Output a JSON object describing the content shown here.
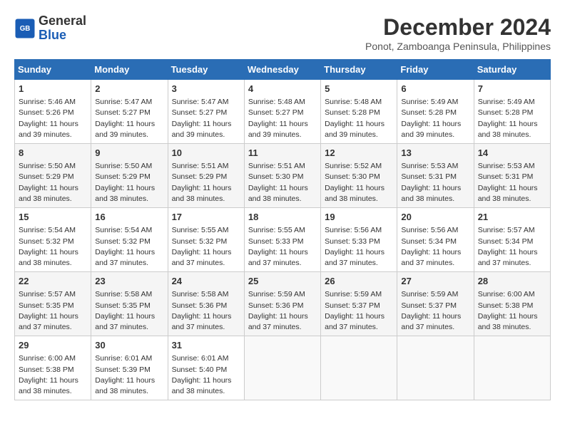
{
  "logo": {
    "line1": "General",
    "line2": "Blue"
  },
  "title": "December 2024",
  "location": "Ponot, Zamboanga Peninsula, Philippines",
  "days_header": [
    "Sunday",
    "Monday",
    "Tuesday",
    "Wednesday",
    "Thursday",
    "Friday",
    "Saturday"
  ],
  "weeks": [
    [
      {
        "day": "1",
        "info": "Sunrise: 5:46 AM\nSunset: 5:26 PM\nDaylight: 11 hours\nand 39 minutes."
      },
      {
        "day": "2",
        "info": "Sunrise: 5:47 AM\nSunset: 5:27 PM\nDaylight: 11 hours\nand 39 minutes."
      },
      {
        "day": "3",
        "info": "Sunrise: 5:47 AM\nSunset: 5:27 PM\nDaylight: 11 hours\nand 39 minutes."
      },
      {
        "day": "4",
        "info": "Sunrise: 5:48 AM\nSunset: 5:27 PM\nDaylight: 11 hours\nand 39 minutes."
      },
      {
        "day": "5",
        "info": "Sunrise: 5:48 AM\nSunset: 5:28 PM\nDaylight: 11 hours\nand 39 minutes."
      },
      {
        "day": "6",
        "info": "Sunrise: 5:49 AM\nSunset: 5:28 PM\nDaylight: 11 hours\nand 39 minutes."
      },
      {
        "day": "7",
        "info": "Sunrise: 5:49 AM\nSunset: 5:28 PM\nDaylight: 11 hours\nand 38 minutes."
      }
    ],
    [
      {
        "day": "8",
        "info": "Sunrise: 5:50 AM\nSunset: 5:29 PM\nDaylight: 11 hours\nand 38 minutes."
      },
      {
        "day": "9",
        "info": "Sunrise: 5:50 AM\nSunset: 5:29 PM\nDaylight: 11 hours\nand 38 minutes."
      },
      {
        "day": "10",
        "info": "Sunrise: 5:51 AM\nSunset: 5:29 PM\nDaylight: 11 hours\nand 38 minutes."
      },
      {
        "day": "11",
        "info": "Sunrise: 5:51 AM\nSunset: 5:30 PM\nDaylight: 11 hours\nand 38 minutes."
      },
      {
        "day": "12",
        "info": "Sunrise: 5:52 AM\nSunset: 5:30 PM\nDaylight: 11 hours\nand 38 minutes."
      },
      {
        "day": "13",
        "info": "Sunrise: 5:53 AM\nSunset: 5:31 PM\nDaylight: 11 hours\nand 38 minutes."
      },
      {
        "day": "14",
        "info": "Sunrise: 5:53 AM\nSunset: 5:31 PM\nDaylight: 11 hours\nand 38 minutes."
      }
    ],
    [
      {
        "day": "15",
        "info": "Sunrise: 5:54 AM\nSunset: 5:32 PM\nDaylight: 11 hours\nand 38 minutes."
      },
      {
        "day": "16",
        "info": "Sunrise: 5:54 AM\nSunset: 5:32 PM\nDaylight: 11 hours\nand 37 minutes."
      },
      {
        "day": "17",
        "info": "Sunrise: 5:55 AM\nSunset: 5:32 PM\nDaylight: 11 hours\nand 37 minutes."
      },
      {
        "day": "18",
        "info": "Sunrise: 5:55 AM\nSunset: 5:33 PM\nDaylight: 11 hours\nand 37 minutes."
      },
      {
        "day": "19",
        "info": "Sunrise: 5:56 AM\nSunset: 5:33 PM\nDaylight: 11 hours\nand 37 minutes."
      },
      {
        "day": "20",
        "info": "Sunrise: 5:56 AM\nSunset: 5:34 PM\nDaylight: 11 hours\nand 37 minutes."
      },
      {
        "day": "21",
        "info": "Sunrise: 5:57 AM\nSunset: 5:34 PM\nDaylight: 11 hours\nand 37 minutes."
      }
    ],
    [
      {
        "day": "22",
        "info": "Sunrise: 5:57 AM\nSunset: 5:35 PM\nDaylight: 11 hours\nand 37 minutes."
      },
      {
        "day": "23",
        "info": "Sunrise: 5:58 AM\nSunset: 5:35 PM\nDaylight: 11 hours\nand 37 minutes."
      },
      {
        "day": "24",
        "info": "Sunrise: 5:58 AM\nSunset: 5:36 PM\nDaylight: 11 hours\nand 37 minutes."
      },
      {
        "day": "25",
        "info": "Sunrise: 5:59 AM\nSunset: 5:36 PM\nDaylight: 11 hours\nand 37 minutes."
      },
      {
        "day": "26",
        "info": "Sunrise: 5:59 AM\nSunset: 5:37 PM\nDaylight: 11 hours\nand 37 minutes."
      },
      {
        "day": "27",
        "info": "Sunrise: 5:59 AM\nSunset: 5:37 PM\nDaylight: 11 hours\nand 37 minutes."
      },
      {
        "day": "28",
        "info": "Sunrise: 6:00 AM\nSunset: 5:38 PM\nDaylight: 11 hours\nand 38 minutes."
      }
    ],
    [
      {
        "day": "29",
        "info": "Sunrise: 6:00 AM\nSunset: 5:38 PM\nDaylight: 11 hours\nand 38 minutes."
      },
      {
        "day": "30",
        "info": "Sunrise: 6:01 AM\nSunset: 5:39 PM\nDaylight: 11 hours\nand 38 minutes."
      },
      {
        "day": "31",
        "info": "Sunrise: 6:01 AM\nSunset: 5:40 PM\nDaylight: 11 hours\nand 38 minutes."
      },
      null,
      null,
      null,
      null
    ]
  ]
}
